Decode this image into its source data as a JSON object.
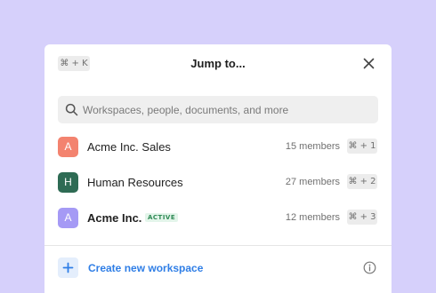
{
  "palette": {
    "background": "#d6d0fb",
    "accent": "#2f7ee6",
    "active_badge": "#2f8a55"
  },
  "header": {
    "shortcut": "⌘ + K",
    "title": "Jump to..."
  },
  "search": {
    "placeholder": "Workspaces, people, documents, and more",
    "value": ""
  },
  "workspaces": [
    {
      "initial": "A",
      "name": "Acme Inc. Sales",
      "members": "15 members",
      "shortcut": "⌘ + 1",
      "avatar_color": "#f3836f",
      "active": false,
      "badge": ""
    },
    {
      "initial": "H",
      "name": "Human Resources",
      "members": "27 members",
      "shortcut": "⌘ + 2",
      "avatar_color": "#2e6b54",
      "active": false,
      "badge": ""
    },
    {
      "initial": "A",
      "name": "Acme Inc.",
      "members": "12 members",
      "shortcut": "⌘ + 3",
      "avatar_color": "#a59af5",
      "active": true,
      "badge": "ACTIVE"
    }
  ],
  "footer": {
    "create_label": "Create new workspace"
  },
  "icons": {
    "close": "close-icon",
    "search": "search-icon",
    "plus": "plus-icon",
    "info": "info-icon"
  }
}
